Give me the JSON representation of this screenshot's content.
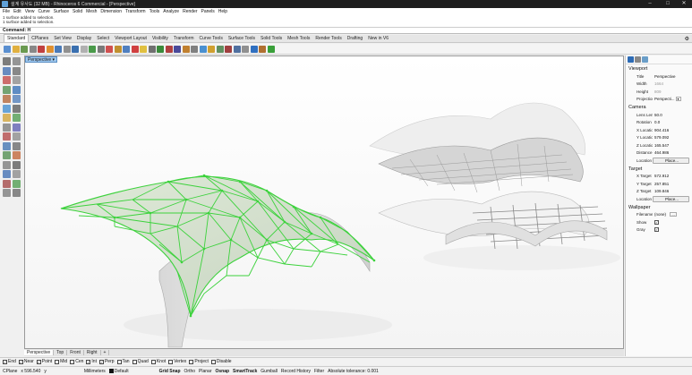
{
  "window": {
    "title": "설계 유사도 (32 MB) - Rhinoceros 6 Commercial - [Perspective]"
  },
  "menu": [
    "File",
    "Edit",
    "View",
    "Curve",
    "Surface",
    "Solid",
    "Mesh",
    "Dimension",
    "Transform",
    "Tools",
    "Analyze",
    "Render",
    "Panels",
    "Help"
  ],
  "history": [
    "1 surface added to selection.",
    "1 surface added to selection."
  ],
  "command": {
    "label": "Command:",
    "value": "H"
  },
  "tabs": [
    "Standard",
    "CPlanes",
    "Set View",
    "Display",
    "Select",
    "Viewport Layout",
    "Visibility",
    "Transform",
    "Curve Tools",
    "Surface Tools",
    "Solid Tools",
    "Mesh Tools",
    "Render Tools",
    "Drafting",
    "New in V6"
  ],
  "viewport": {
    "label": "Perspective",
    "tabs": [
      "Perspective",
      "Top",
      "Front",
      "Right"
    ],
    "add": "+"
  },
  "osnap": [
    {
      "label": "End",
      "checked": true
    },
    {
      "label": "Near",
      "checked": true
    },
    {
      "label": "Point",
      "checked": true
    },
    {
      "label": "Mid",
      "checked": false
    },
    {
      "label": "Cen",
      "checked": false
    },
    {
      "label": "Int",
      "checked": true
    },
    {
      "label": "Perp",
      "checked": true
    },
    {
      "label": "Tan",
      "checked": false
    },
    {
      "label": "Quad",
      "checked": false
    },
    {
      "label": "Knot",
      "checked": false
    },
    {
      "label": "Vertex",
      "checked": false
    },
    {
      "label": "Project",
      "checked": false
    },
    {
      "label": "Disable",
      "checked": false
    }
  ],
  "status": {
    "cplane": "CPlane",
    "x": "x 596.540",
    "y": "y",
    "units": "Millimeters",
    "layer": "Default",
    "grid": "Grid Snap",
    "ortho": "Ortho",
    "planar": "Planar",
    "osnap": "Osnap",
    "smarttrack": "SmartTrack",
    "gumball": "Gumball",
    "record": "Record History",
    "filter": "Filter",
    "tolerance": "Absolute tolerance: 0.001"
  },
  "panel": {
    "viewport_title": "Viewport",
    "viewport": [
      {
        "k": "Title",
        "v": "Perspective",
        "dim": false
      },
      {
        "k": "Width",
        "v": "1664",
        "dim": true
      },
      {
        "k": "Height",
        "v": "809",
        "dim": true
      },
      {
        "k": "Projection",
        "v": "Perspecti...",
        "dim": false,
        "drop": true
      }
    ],
    "camera_title": "Camera",
    "camera": [
      {
        "k": "Lens Len...",
        "v": "50.0"
      },
      {
        "k": "Rotation",
        "v": "0.0"
      },
      {
        "k": "X Location",
        "v": "904.416"
      },
      {
        "k": "Y Location",
        "v": "579.092"
      },
      {
        "k": "Z Location",
        "v": "165.547"
      },
      {
        "k": "Distance ...",
        "v": "464.986"
      },
      {
        "k": "Location",
        "v": "Place...",
        "btn": true
      }
    ],
    "target_title": "Target",
    "target": [
      {
        "k": "X Target",
        "v": "572.912"
      },
      {
        "k": "Y Target",
        "v": "257.851"
      },
      {
        "k": "Z Target",
        "v": "109.846"
      },
      {
        "k": "Location",
        "v": "Place...",
        "btn": true
      }
    ],
    "wallpaper_title": "Wallpaper",
    "wallpaper": [
      {
        "k": "Filename",
        "v": "(none)",
        "more": "..."
      },
      {
        "k": "Show",
        "v": "",
        "check": true
      },
      {
        "k": "Gray",
        "v": "",
        "check": true
      }
    ]
  },
  "colors": {
    "selection": "#3cd23c",
    "panel_bg": "#fafafa",
    "accent": "#9ec7ee"
  }
}
